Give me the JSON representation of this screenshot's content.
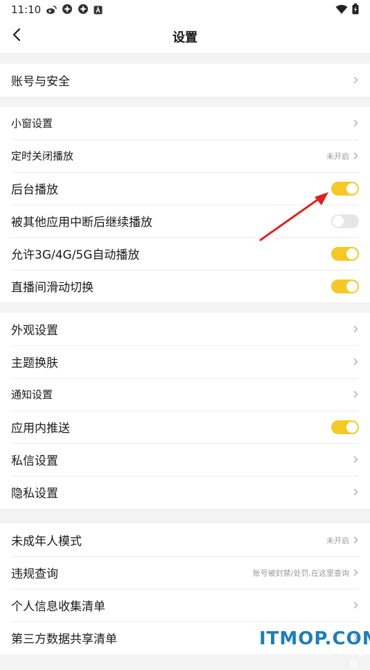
{
  "status_bar": {
    "time": "11:10",
    "icons": [
      "weibo-icon",
      "pinwheel-icon",
      "pinwheel-icon",
      "a-badge-icon"
    ],
    "right_icons": [
      "wifi-icon",
      "battery-icon"
    ]
  },
  "header": {
    "title": "设置"
  },
  "groups": [
    {
      "items": [
        {
          "label": "账号与安全",
          "type": "nav"
        }
      ]
    },
    {
      "items": [
        {
          "label": "小窗设置",
          "type": "nav"
        },
        {
          "label": "定时关闭播放",
          "type": "nav",
          "hint": "未开启"
        },
        {
          "label": "后台播放",
          "type": "toggle",
          "on": true
        },
        {
          "label": "被其他应用中断后继续播放",
          "type": "toggle",
          "on": false
        },
        {
          "label": "允许3G/4G/5G自动播放",
          "type": "toggle",
          "on": true
        },
        {
          "label": "直播间滑动切换",
          "type": "toggle",
          "on": true
        }
      ]
    },
    {
      "items": [
        {
          "label": "外观设置",
          "type": "nav"
        },
        {
          "label": "主题换肤",
          "type": "nav"
        },
        {
          "label": "通知设置",
          "type": "nav"
        },
        {
          "label": "应用内推送",
          "type": "toggle",
          "on": true
        },
        {
          "label": "私信设置",
          "type": "nav"
        },
        {
          "label": "隐私设置",
          "type": "nav"
        }
      ]
    },
    {
      "items": [
        {
          "label": "未成年人模式",
          "type": "nav",
          "hint": "未开启"
        },
        {
          "label": "违规查询",
          "type": "nav",
          "hint": "账号被封禁/处罚,在这里查询"
        },
        {
          "label": "个人信息收集清单",
          "type": "nav"
        },
        {
          "label": "第三方数据共享清单",
          "type": "nav"
        }
      ]
    }
  ],
  "colors": {
    "toggle_on": "#f5c925",
    "toggle_off": "#e6e6e6",
    "annotation_arrow": "#e02020"
  },
  "watermark": {
    "brand": "ITMOP.COM",
    "php": "php",
    "cn": "中文网"
  }
}
